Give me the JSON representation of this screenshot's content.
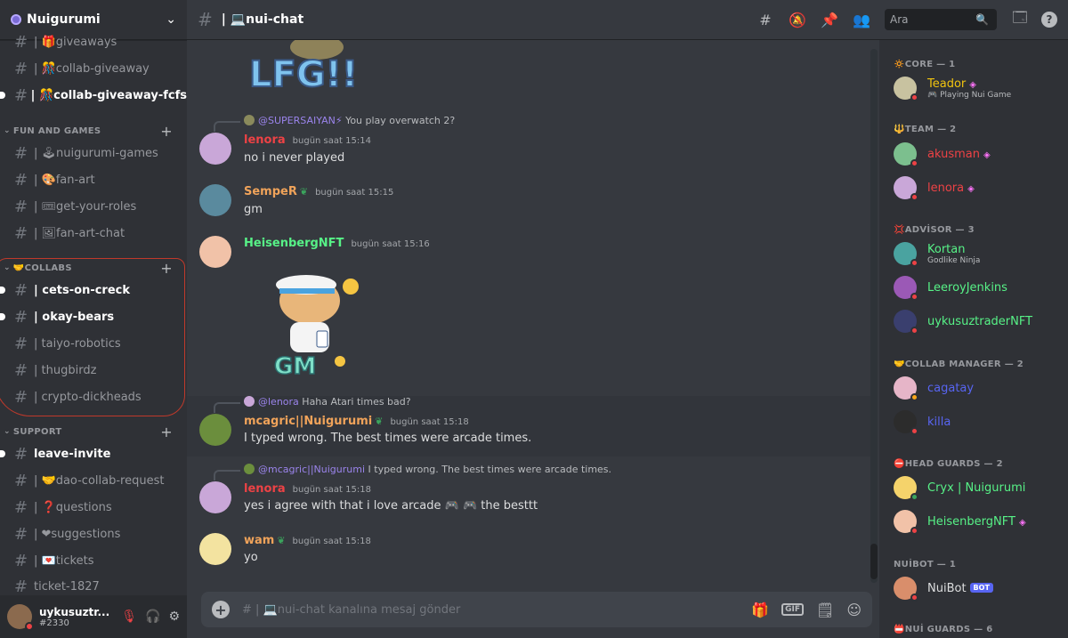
{
  "server": {
    "name": "Nuigurumi"
  },
  "sidebar": {
    "channels_top": [
      {
        "label": "| 🎁giveaways",
        "unread": false
      },
      {
        "label": "| 🎊collab-giveaway",
        "unread": false
      },
      {
        "label": "| 🎊collab-giveaway-fcfs",
        "unread": true
      }
    ],
    "fun": {
      "title": "FUN AND GAMES",
      "items": [
        {
          "label": "| 🕹nuigurumi-games",
          "unread": false
        },
        {
          "label": "| 🎨fan-art",
          "unread": false
        },
        {
          "label": "| 🎟get-your-roles",
          "unread": false
        },
        {
          "label": "| 🖼fan-art-chat",
          "unread": false
        }
      ]
    },
    "collabs": {
      "title": "🤝COLLABS",
      "items": [
        {
          "label": "| cets-on-creck",
          "unread": true
        },
        {
          "label": "| okay-bears",
          "unread": true
        },
        {
          "label": "| taiyo-robotics",
          "unread": false
        },
        {
          "label": "| thugbirdz",
          "unread": false
        },
        {
          "label": "| crypto-dickheads",
          "unread": false
        }
      ]
    },
    "support": {
      "title": "SUPPORT",
      "items": [
        {
          "label": "leave-invite",
          "unread": true
        },
        {
          "label": "| 🤝dao-collab-request",
          "unread": false
        },
        {
          "label": "| ❓questions",
          "unread": false
        },
        {
          "label": "| ❤suggestions",
          "unread": false
        },
        {
          "label": "| 💌tickets",
          "unread": false
        },
        {
          "label": "ticket-1827",
          "unread": false
        }
      ]
    }
  },
  "user": {
    "name": "uykusuztr...",
    "tag": "#2330"
  },
  "header": {
    "channel": "| 💻nui-chat",
    "search_placeholder": "Ara"
  },
  "chat": {
    "lfg_text": "LFG!!",
    "gm_text": "GM",
    "messages": [
      {
        "reply_name": "@SUPERSAIYAN⚡",
        "reply_text": "You play overwatch 2?",
        "author": "lenora",
        "time": "bugün saat 15:14",
        "text": "no i never played",
        "color": "#ed4245"
      },
      {
        "author": "SempeR",
        "time": "bugün saat 15:15",
        "text": "gm",
        "color": "#f0a35a"
      },
      {
        "author": "HeisenbergNFT",
        "time": "bugün saat 15:16",
        "text": "",
        "color": "#57f287"
      },
      {
        "reply_name": "@lenora",
        "reply_text": "Haha Atari times bad?",
        "author": "mcagric||Nuigurumi",
        "time": "bugün saat 15:18",
        "text": "I typed wrong. The best times were arcade times.",
        "color": "#f0a35a"
      },
      {
        "reply_name": "@mcagric||Nuigurumi",
        "reply_text": "I typed wrong. The best times were arcade times.",
        "author": "lenora",
        "time": "bugün saat 15:18",
        "text": "yes i agree with that i love arcade 🎮 🎮 the besttt",
        "color": "#ed4245"
      },
      {
        "author": "wam",
        "time": "bugün saat 15:18",
        "text": "yo",
        "color": "#f0a35a"
      }
    ],
    "composer_placeholder": "# | 💻nui-chat kanalına mesaj gönder"
  },
  "members": {
    "groups": [
      {
        "title": "🔅CORE — 1",
        "members": [
          {
            "name": "Teador",
            "sub": "🎮 Playing Nui Game",
            "color": "#f1c40f",
            "boost": true,
            "online": false
          }
        ]
      },
      {
        "title": "🔱TEAM — 2",
        "members": [
          {
            "name": "akusman",
            "sub": "",
            "color": "#ed4245",
            "boost": true,
            "online": false
          },
          {
            "name": "lenora",
            "sub": "",
            "color": "#ed4245",
            "boost": true,
            "online": false
          }
        ]
      },
      {
        "title": "💢ADVİSOR — 3",
        "members": [
          {
            "name": "Kortan",
            "sub": "Godlike Ninja",
            "color": "#57f287",
            "boost": false,
            "online": false
          },
          {
            "name": "LeeroyJenkins",
            "sub": "",
            "color": "#57f287",
            "boost": false,
            "online": false
          },
          {
            "name": "uykusuztraderNFT",
            "sub": "",
            "color": "#57f287",
            "boost": false,
            "online": false
          }
        ]
      },
      {
        "title": "🤝COLLAB MANAGER — 2",
        "members": [
          {
            "name": "cagatay",
            "sub": "",
            "color": "#5865f2",
            "boost": false,
            "online": false
          },
          {
            "name": "killa",
            "sub": "",
            "color": "#5865f2",
            "boost": false,
            "online": false
          }
        ]
      },
      {
        "title": "⛔HEAD GUARDS — 2",
        "members": [
          {
            "name": "Cryx | Nuigurumi",
            "sub": "",
            "color": "#57f287",
            "boost": false,
            "online": true
          },
          {
            "name": "HeisenbergNFT",
            "sub": "",
            "color": "#57f287",
            "boost": true,
            "online": false
          }
        ]
      },
      {
        "title": "NUİBOT — 1",
        "members": [
          {
            "name": "NuiBot",
            "sub": "",
            "color": "#dcddde",
            "boost": false,
            "online": false,
            "bot": "BOT"
          }
        ]
      },
      {
        "title": "📛NUİ GUARDS — 6",
        "members": []
      }
    ]
  }
}
